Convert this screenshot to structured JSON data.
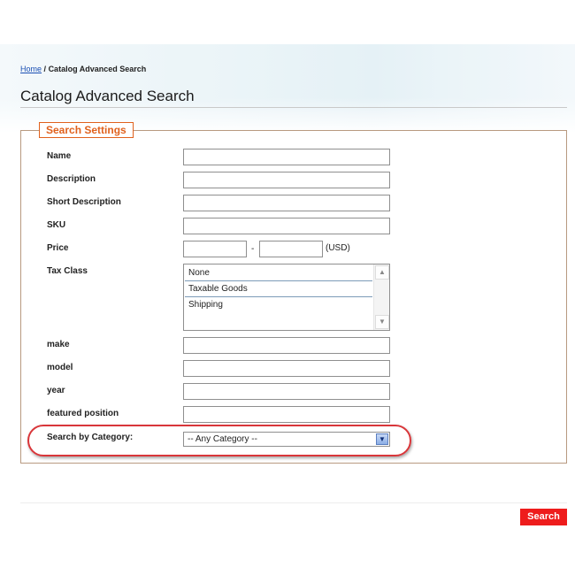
{
  "breadcrumb": {
    "home": "Home",
    "separator": "/",
    "current": "Catalog Advanced Search"
  },
  "page": {
    "title": "Catalog Advanced Search"
  },
  "fieldset": {
    "legend": "Search Settings",
    "labels": {
      "name": "Name",
      "description": "Description",
      "short_description": "Short Description",
      "sku": "SKU",
      "price": "Price",
      "tax_class": "Tax Class",
      "make": "make",
      "model": "model",
      "year": "year",
      "featured_position": "featured position",
      "category": "Search by Category:"
    },
    "price_separator": "-",
    "currency": "(USD)",
    "tax_options": [
      "None",
      "Taxable Goods",
      "Shipping"
    ],
    "category_selected": "-- Any Category --"
  },
  "buttons": {
    "search": "Search"
  },
  "colors": {
    "accent": "#e0611d",
    "search_button": "#ee1c1c",
    "highlight": "#d9363a"
  }
}
